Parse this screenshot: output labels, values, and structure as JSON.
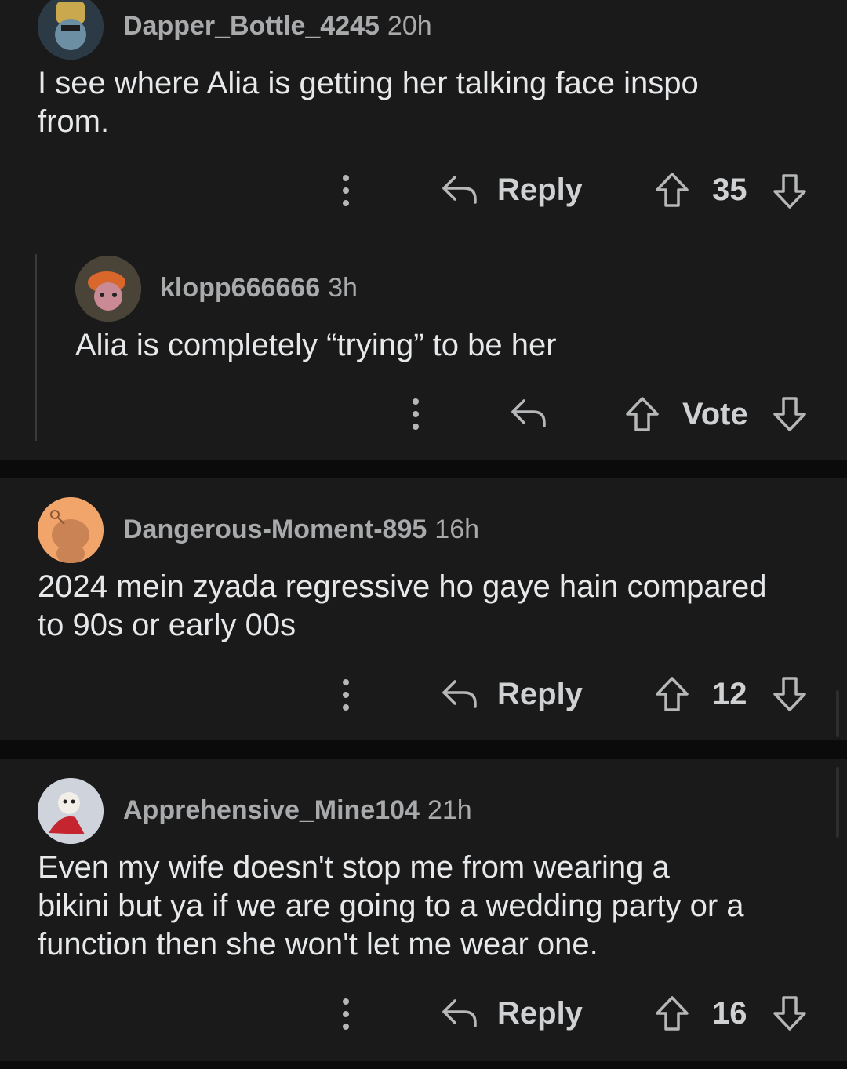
{
  "comments": [
    {
      "username": "Dapper_Bottle_4245",
      "age": "20h",
      "text_lines": [
        "I see where Alia is getting her talking face inspo",
        "from."
      ],
      "reply_label": "Reply",
      "vote_label": "35"
    },
    {
      "username": "klopp666666",
      "age": "3h",
      "text_lines": [
        "Alia is completely “trying” to be her"
      ],
      "vote_label": "Vote"
    },
    {
      "username": "Dangerous-Moment-895",
      "age": "16h",
      "text_lines": [
        "2024 mein zyada regressive ho gaye hain compared",
        "to 90s or early 00s"
      ],
      "reply_label": "Reply",
      "vote_label": "12"
    },
    {
      "username": "Apprehensive_Mine104",
      "age": "21h",
      "text_lines": [
        "Even my wife doesn't stop me from wearing a",
        "bikini but ya if we are going to a wedding party or a",
        "function then she won't let me wear one."
      ],
      "reply_label": "Reply",
      "vote_label": "16"
    }
  ],
  "icons": {
    "more": "vertical-dots-icon",
    "reply": "reply-arrow-icon",
    "upvote": "upvote-arrow-icon",
    "downvote": "downvote-arrow-icon"
  },
  "colors": {
    "background": "#0b0b0b",
    "card": "#1a1a1b",
    "text": "#e6e8e9",
    "muted": "#a8aaab"
  }
}
